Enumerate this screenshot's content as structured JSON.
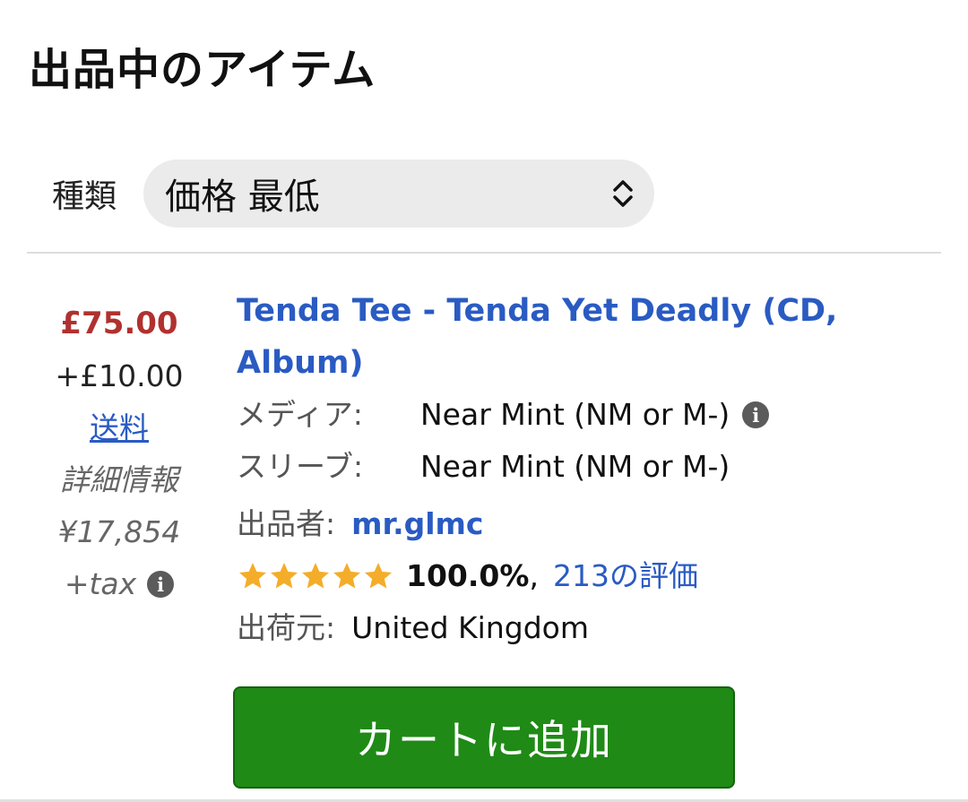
{
  "header": {
    "title": "出品中のアイテム"
  },
  "sort": {
    "label": "種類",
    "selected": "価格 最低"
  },
  "listing": {
    "price": "£75.00",
    "shipping_cost": "+£10.00",
    "shipping_link": "送料",
    "details_label": "詳細情報",
    "approx_price": "¥17,854",
    "tax_label": "+tax",
    "title": "Tenda Tee - Tenda Yet Deadly (CD, Album)",
    "media_label": "メディア:",
    "media_condition": "Near Mint (NM or M-)",
    "sleeve_label": "スリーブ:",
    "sleeve_condition": "Near Mint (NM or M-)",
    "seller_label": "出品者:",
    "seller_name": "mr.glmc",
    "rating_stars": 5,
    "rating_percent": "100.0%",
    "rating_separator": ",",
    "ratings_count_link": "213の評価",
    "ships_from_label": "出荷元:",
    "ships_from": "United Kingdom"
  },
  "actions": {
    "add_to_cart": "カートに追加"
  },
  "icons": {
    "info": "info-icon",
    "chevron": "chevron-up-down-icon",
    "star": "star-icon"
  },
  "colors": {
    "price": "#b0312f",
    "link": "#2a5bc3",
    "button": "#1f8a16",
    "star": "#f4ad2a"
  }
}
